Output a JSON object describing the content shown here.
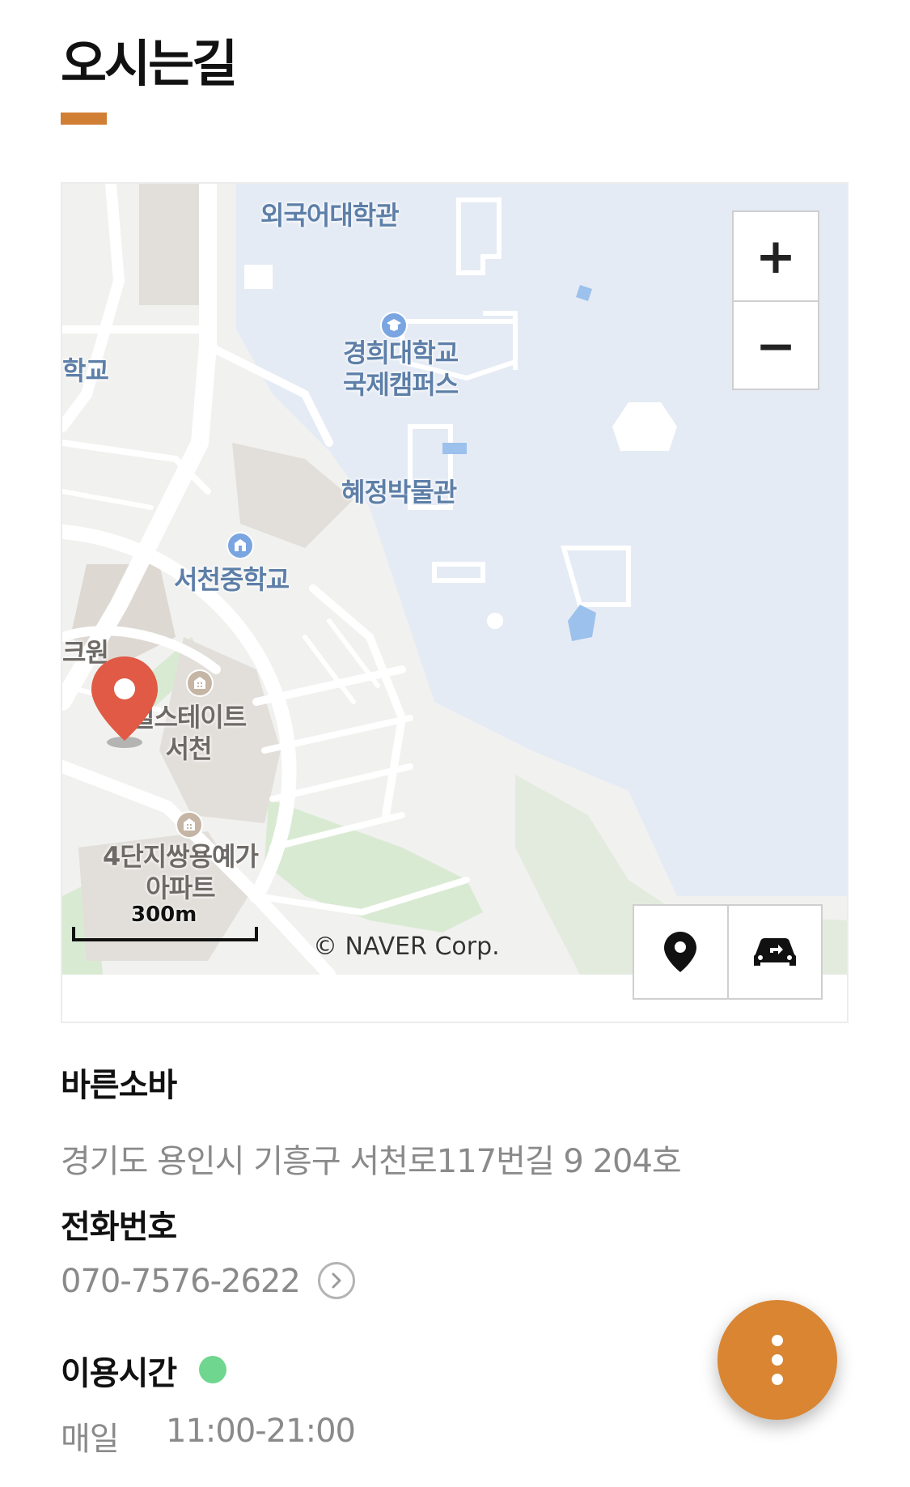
{
  "page": {
    "title": "오시는길",
    "accent_color": "#d27f36"
  },
  "map": {
    "labels": {
      "foreign_lang_hall": "외국어대학관",
      "univ_line1": "경희대학교",
      "univ_line2": "국제캠퍼스",
      "school_fragment": "학교",
      "museum": "혜정박물관",
      "middle_school": "서천중학교",
      "park_fragment": "크원",
      "estate_line1": "힐스테이트",
      "estate_line2": "서천",
      "apt_line1": "4단지쌍용예가",
      "apt_line2": "아파트"
    },
    "zoom_in_label": "+",
    "zoom_out_label": "−",
    "scale_label": "300m",
    "copyright": "© NAVER Corp.",
    "icons": {
      "marker": "map-pin-icon",
      "location": "location-pin-icon",
      "directions": "car-directions-icon"
    },
    "colors": {
      "water": "#e5ebf5",
      "park": "#d9ead2",
      "marker": "#e05a45"
    }
  },
  "business": {
    "name": "바른소바",
    "address": "경기도 용인시 기흥구 서천로117번길 9 204호"
  },
  "phone": {
    "heading": "전화번호",
    "number": "070-7576-2622"
  },
  "hours": {
    "heading": "이용시간",
    "status_color": "#6fd68f",
    "day_label": "매일",
    "time": "11:00-21:00"
  },
  "fab": {
    "icon": "more-vertical-icon",
    "color": "#d98531"
  }
}
